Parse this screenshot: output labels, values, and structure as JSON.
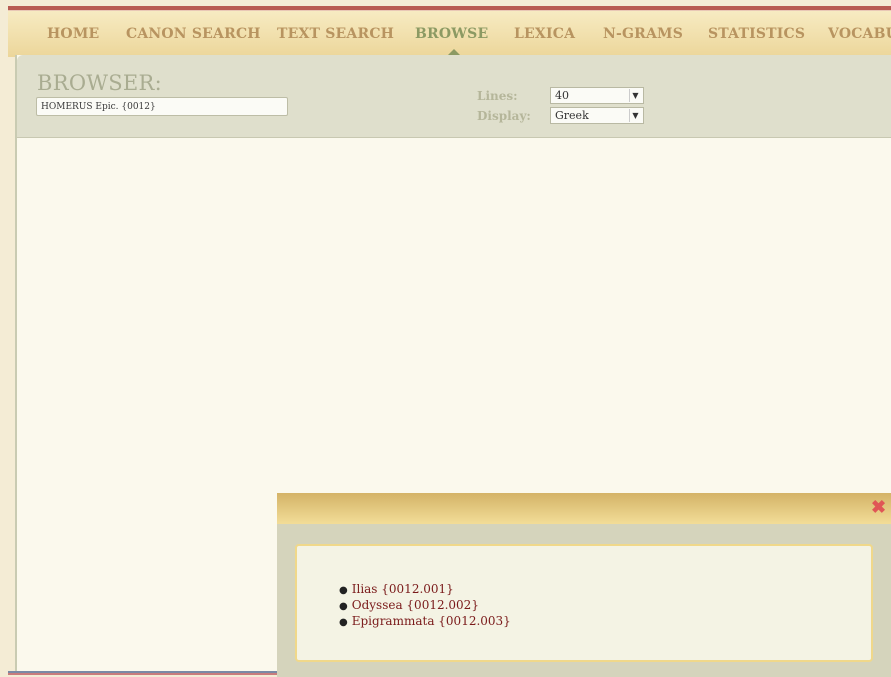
{
  "nav": {
    "items": [
      {
        "label": "HOME"
      },
      {
        "label": "CANON SEARCH"
      },
      {
        "label": "TEXT SEARCH"
      },
      {
        "label": "BROWSE"
      },
      {
        "label": "LEXICA"
      },
      {
        "label": "N-GRAMS"
      },
      {
        "label": "STATISTICS"
      },
      {
        "label": "VOCABU"
      }
    ],
    "active": "BROWSE"
  },
  "browser": {
    "title": "BROWSER:",
    "author_value": "HOMERUS Epic. {0012}",
    "lines_label": "Lines:",
    "lines_value": "40",
    "display_label": "Display:",
    "display_value": "Greek"
  },
  "popup": {
    "works": [
      {
        "label": "Ilias {0012.001}"
      },
      {
        "label": "Odyssea {0012.002}"
      },
      {
        "label": "Epigrammata {0012.003}"
      }
    ]
  },
  "colors": {
    "accent_active": "#8c9a63",
    "nav_text": "#b89460",
    "link": "#7a1a1a",
    "close": "#e05656"
  }
}
